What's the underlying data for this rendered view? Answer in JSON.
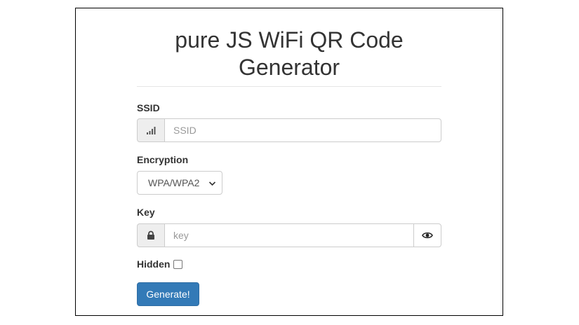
{
  "header": {
    "title_line1": "pure JS WiFi QR Code",
    "title_line2": "Generator"
  },
  "form": {
    "ssid": {
      "label": "SSID",
      "placeholder": "SSID",
      "value": "",
      "icon": "signal-icon"
    },
    "encryption": {
      "label": "Encryption",
      "selected": "WPA/WPA2"
    },
    "key": {
      "label": "Key",
      "placeholder": "key",
      "value": "",
      "icon": "lock-icon",
      "toggle_icon": "eye-icon"
    },
    "hidden": {
      "label": "Hidden",
      "checked": false
    },
    "submit_label": "Generate!"
  },
  "colors": {
    "primary": "#337ab7",
    "text": "#333333",
    "border": "#cccccc",
    "addon_bg": "#eeeeee"
  }
}
